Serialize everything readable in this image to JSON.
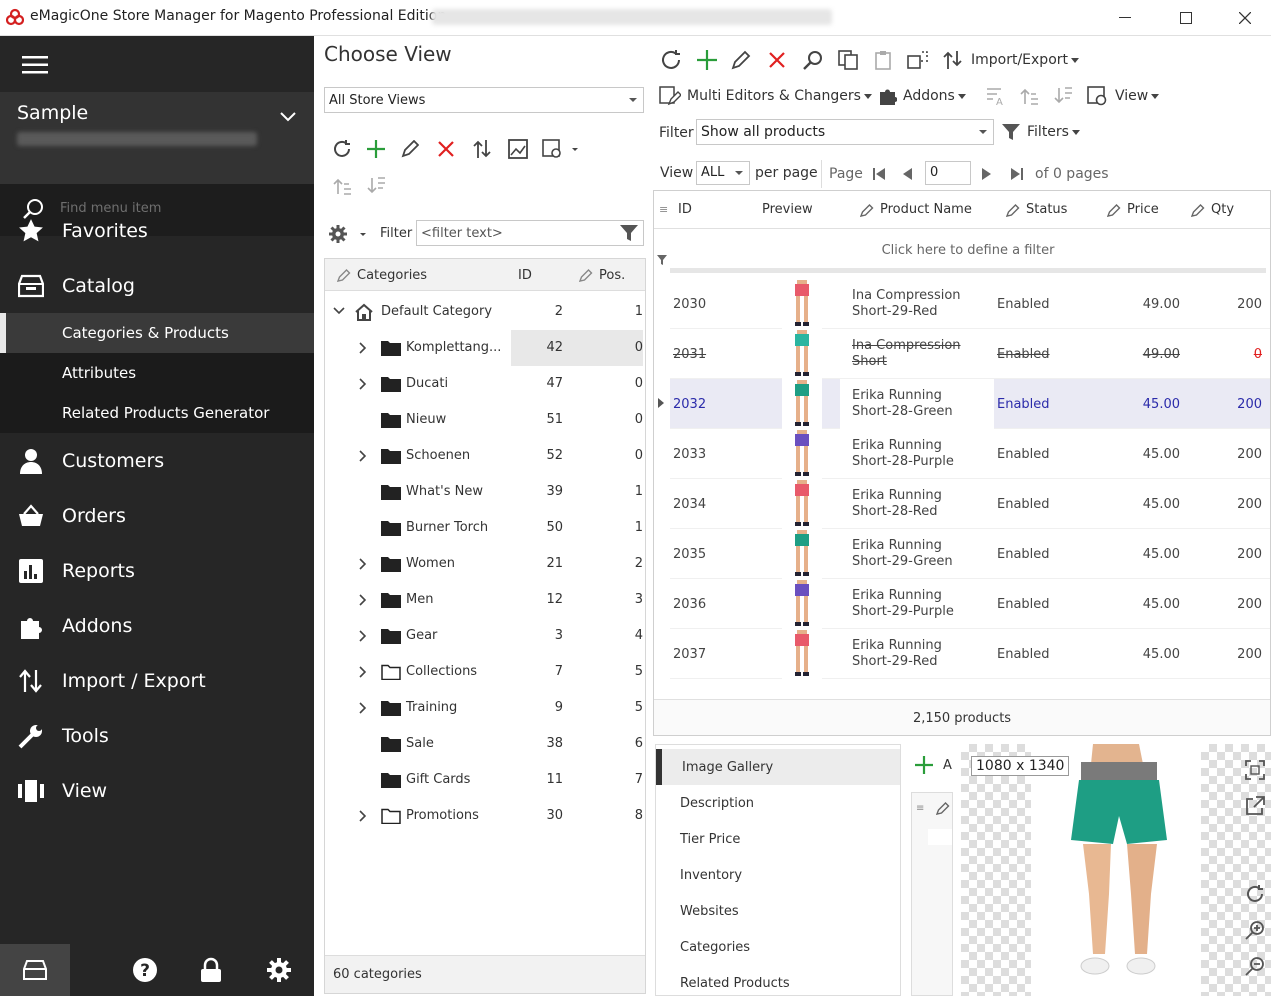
{
  "window": {
    "title": "eMagicOne Store Manager for Magento Professional Edition"
  },
  "sidebar": {
    "store_name": "Sample",
    "search_placeholder": "Find menu item",
    "items": [
      {
        "label": "Favorites",
        "icon": "star-icon"
      },
      {
        "label": "Catalog",
        "icon": "catalog-icon"
      },
      {
        "label": "Customers",
        "icon": "person-icon"
      },
      {
        "label": "Orders",
        "icon": "basket-icon"
      },
      {
        "label": "Reports",
        "icon": "chart-icon"
      },
      {
        "label": "Addons",
        "icon": "puzzle-icon"
      },
      {
        "label": "Import / Export",
        "icon": "arrows-icon"
      },
      {
        "label": "Tools",
        "icon": "wrench-icon"
      },
      {
        "label": "View",
        "icon": "view-icon"
      }
    ],
    "sub_items": [
      "Categories & Products",
      "Attributes",
      "Related Products Generator"
    ]
  },
  "middle": {
    "title": "Choose View",
    "store_view": "All Store Views",
    "filter_label": "Filter",
    "filter_placeholder": "<filter text>",
    "columns": {
      "categories": "Categories",
      "id": "ID",
      "pos": "Pos."
    },
    "rows": [
      {
        "name": "Default Category",
        "id": "2",
        "pos": "1"
      },
      {
        "name": "Komplettang...",
        "id": "42",
        "pos": "0"
      },
      {
        "name": "Ducati",
        "id": "47",
        "pos": "0"
      },
      {
        "name": "Nieuw",
        "id": "51",
        "pos": "0"
      },
      {
        "name": "Schoenen",
        "id": "52",
        "pos": "0"
      },
      {
        "name": "What's New",
        "id": "39",
        "pos": "1"
      },
      {
        "name": "Burner Torch",
        "id": "50",
        "pos": "1"
      },
      {
        "name": "Women",
        "id": "21",
        "pos": "2"
      },
      {
        "name": "Men",
        "id": "12",
        "pos": "3"
      },
      {
        "name": "Gear",
        "id": "3",
        "pos": "4"
      },
      {
        "name": "Collections",
        "id": "7",
        "pos": "5"
      },
      {
        "name": "Training",
        "id": "9",
        "pos": "5"
      },
      {
        "name": "Sale",
        "id": "38",
        "pos": "6"
      },
      {
        "name": "Gift Cards",
        "id": "11",
        "pos": "7"
      },
      {
        "name": "Promotions",
        "id": "30",
        "pos": "8"
      }
    ],
    "footer": "60 categories"
  },
  "toolbar": {
    "import_export": "Import/Export",
    "multi_editors": "Multi Editors & Changers",
    "addons": "Addons",
    "view": "View",
    "filter_label": "Filter",
    "filter_value": "Show all products",
    "filters": "Filters",
    "view_label": "View",
    "view_value": "ALL",
    "per_page": "per page",
    "page_label": "Page",
    "page_value": "0",
    "of_pages": "of 0 pages"
  },
  "grid": {
    "columns": {
      "id": "ID",
      "preview": "Preview",
      "name": "Product Name",
      "status": "Status",
      "price": "Price",
      "qty": "Qty"
    },
    "filter_hint": "Click here to define a filter",
    "rows": [
      {
        "id": "2030",
        "name1": "Ina Compression",
        "name2": "Short-29-Red",
        "status": "Enabled",
        "price": "49.00",
        "qty": "200"
      },
      {
        "id": "2031",
        "name1": "Ina Compression",
        "name2": "Short",
        "status": "Enabled",
        "price": "49.00",
        "qty": "0"
      },
      {
        "id": "2032",
        "name1": "Erika Running",
        "name2": "Short-28-Green",
        "status": "Enabled",
        "price": "45.00",
        "qty": "200"
      },
      {
        "id": "2033",
        "name1": "Erika Running",
        "name2": "Short-28-Purple",
        "status": "Enabled",
        "price": "45.00",
        "qty": "200"
      },
      {
        "id": "2034",
        "name1": "Erika Running",
        "name2": "Short-28-Red",
        "status": "Enabled",
        "price": "45.00",
        "qty": "200"
      },
      {
        "id": "2035",
        "name1": "Erika Running",
        "name2": "Short-29-Green",
        "status": "Enabled",
        "price": "45.00",
        "qty": "200"
      },
      {
        "id": "2036",
        "name1": "Erika Running",
        "name2": "Short-29-Purple",
        "status": "Enabled",
        "price": "45.00",
        "qty": "200"
      },
      {
        "id": "2037",
        "name1": "Erika Running",
        "name2": "Short-29-Red",
        "status": "Enabled",
        "price": "45.00",
        "qty": "200"
      }
    ],
    "footer": "2,150 products"
  },
  "detail_tabs": [
    "Image Gallery",
    "Description",
    "Tier Price",
    "Inventory",
    "Websites",
    "Categories",
    "Related Products"
  ],
  "image": {
    "dimensions": "1080 x 1340",
    "add_label": "A"
  },
  "colors": {
    "sidebar": "#262626",
    "accent_green": "#2a9d3a",
    "accent_red": "#e02020",
    "selected_text": "#2b2baa"
  }
}
